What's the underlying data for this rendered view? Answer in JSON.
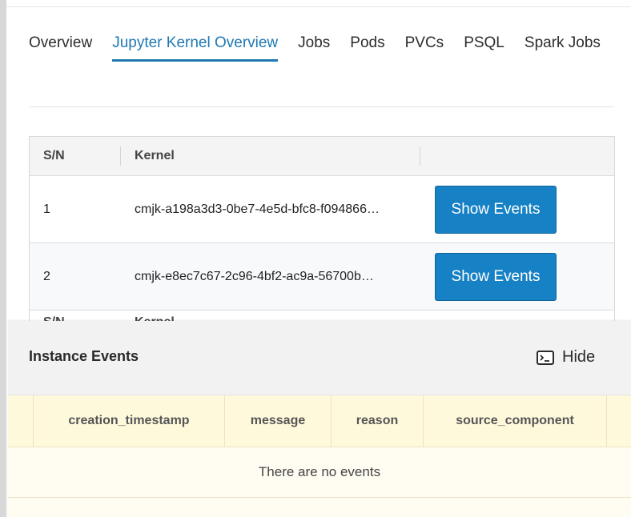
{
  "tabs": [
    {
      "label": "Overview",
      "active": false
    },
    {
      "label": "Jupyter Kernel Overview",
      "active": true
    },
    {
      "label": "Jobs",
      "active": false
    },
    {
      "label": "Pods",
      "active": false
    },
    {
      "label": "PVCs",
      "active": false
    },
    {
      "label": "PSQL",
      "active": false
    },
    {
      "label": "Spark Jobs",
      "active": false
    }
  ],
  "kernel_table": {
    "headers": {
      "sn": "S/N",
      "kernel": "Kernel"
    },
    "rows": [
      {
        "sn": "1",
        "kernel": "cmjk-a198a3d3-0be7-4e5d-bfc8-f094866…",
        "action_label": "Show Events"
      },
      {
        "sn": "2",
        "kernel": "cmjk-e8ec7c67-2c96-4bf2-ac9a-56700b…",
        "action_label": "Show Events"
      }
    ],
    "repeated_header_partial": {
      "sn": "S/N",
      "kernel": "Kernel"
    }
  },
  "events_panel": {
    "title": "Instance Events",
    "hide_label": "Hide",
    "hide_icon": "terminal-icon",
    "columns": [
      "creation_timestamp",
      "message",
      "reason",
      "source_component"
    ],
    "empty_text": "There are no events"
  },
  "colors": {
    "accent": "#1f78b4",
    "button": "#1681c5",
    "events_bg": "#fff9dc"
  }
}
